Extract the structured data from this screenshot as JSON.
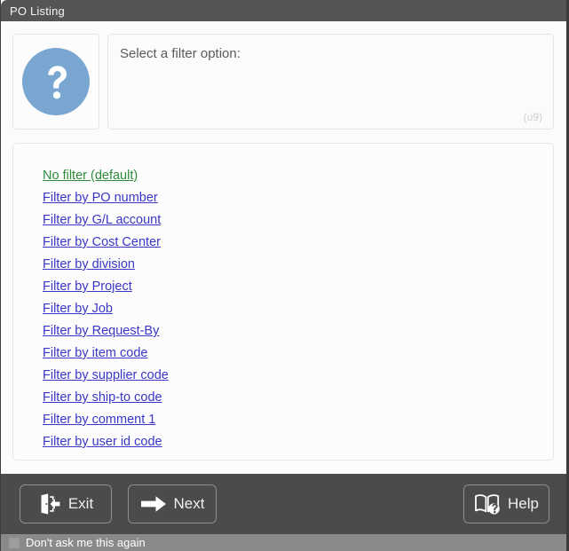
{
  "window": {
    "title": "PO Listing"
  },
  "header": {
    "icon": "question-mark-circle-icon",
    "prompt": "Select a filter option:",
    "tag": "(u9)"
  },
  "filters": [
    {
      "label": "No filter (default)",
      "state": "visited"
    },
    {
      "label": "Filter by PO number",
      "state": "default"
    },
    {
      "label": "Filter by G/L account",
      "state": "default"
    },
    {
      "label": "Filter by Cost Center",
      "state": "default"
    },
    {
      "label": "Filter by division",
      "state": "default"
    },
    {
      "label": "Filter by Project",
      "state": "default"
    },
    {
      "label": "Filter by Job",
      "state": "default"
    },
    {
      "label": "Filter by Request-By",
      "state": "default"
    },
    {
      "label": "Filter by item code",
      "state": "default"
    },
    {
      "label": "Filter by supplier code",
      "state": "default"
    },
    {
      "label": "Filter by ship-to code",
      "state": "default"
    },
    {
      "label": "Filter by comment 1",
      "state": "default"
    },
    {
      "label": "Filter by user id code",
      "state": "default"
    }
  ],
  "buttons": {
    "exit": {
      "label": "Exit",
      "icon": "exit-door-icon"
    },
    "next": {
      "label": "Next",
      "icon": "arrow-right-icon"
    },
    "help": {
      "label": "Help",
      "icon": "book-question-icon"
    }
  },
  "footer": {
    "checkbox_label": "Don't ask me this again",
    "checked": false
  },
  "colors": {
    "titlebar": "#555555",
    "buttonbar": "#4b4b4b",
    "footer": "#8a8a8a",
    "link": "#3a36c8",
    "link_visited": "#2e8b3d",
    "icon_blue": "#79a7d2"
  }
}
